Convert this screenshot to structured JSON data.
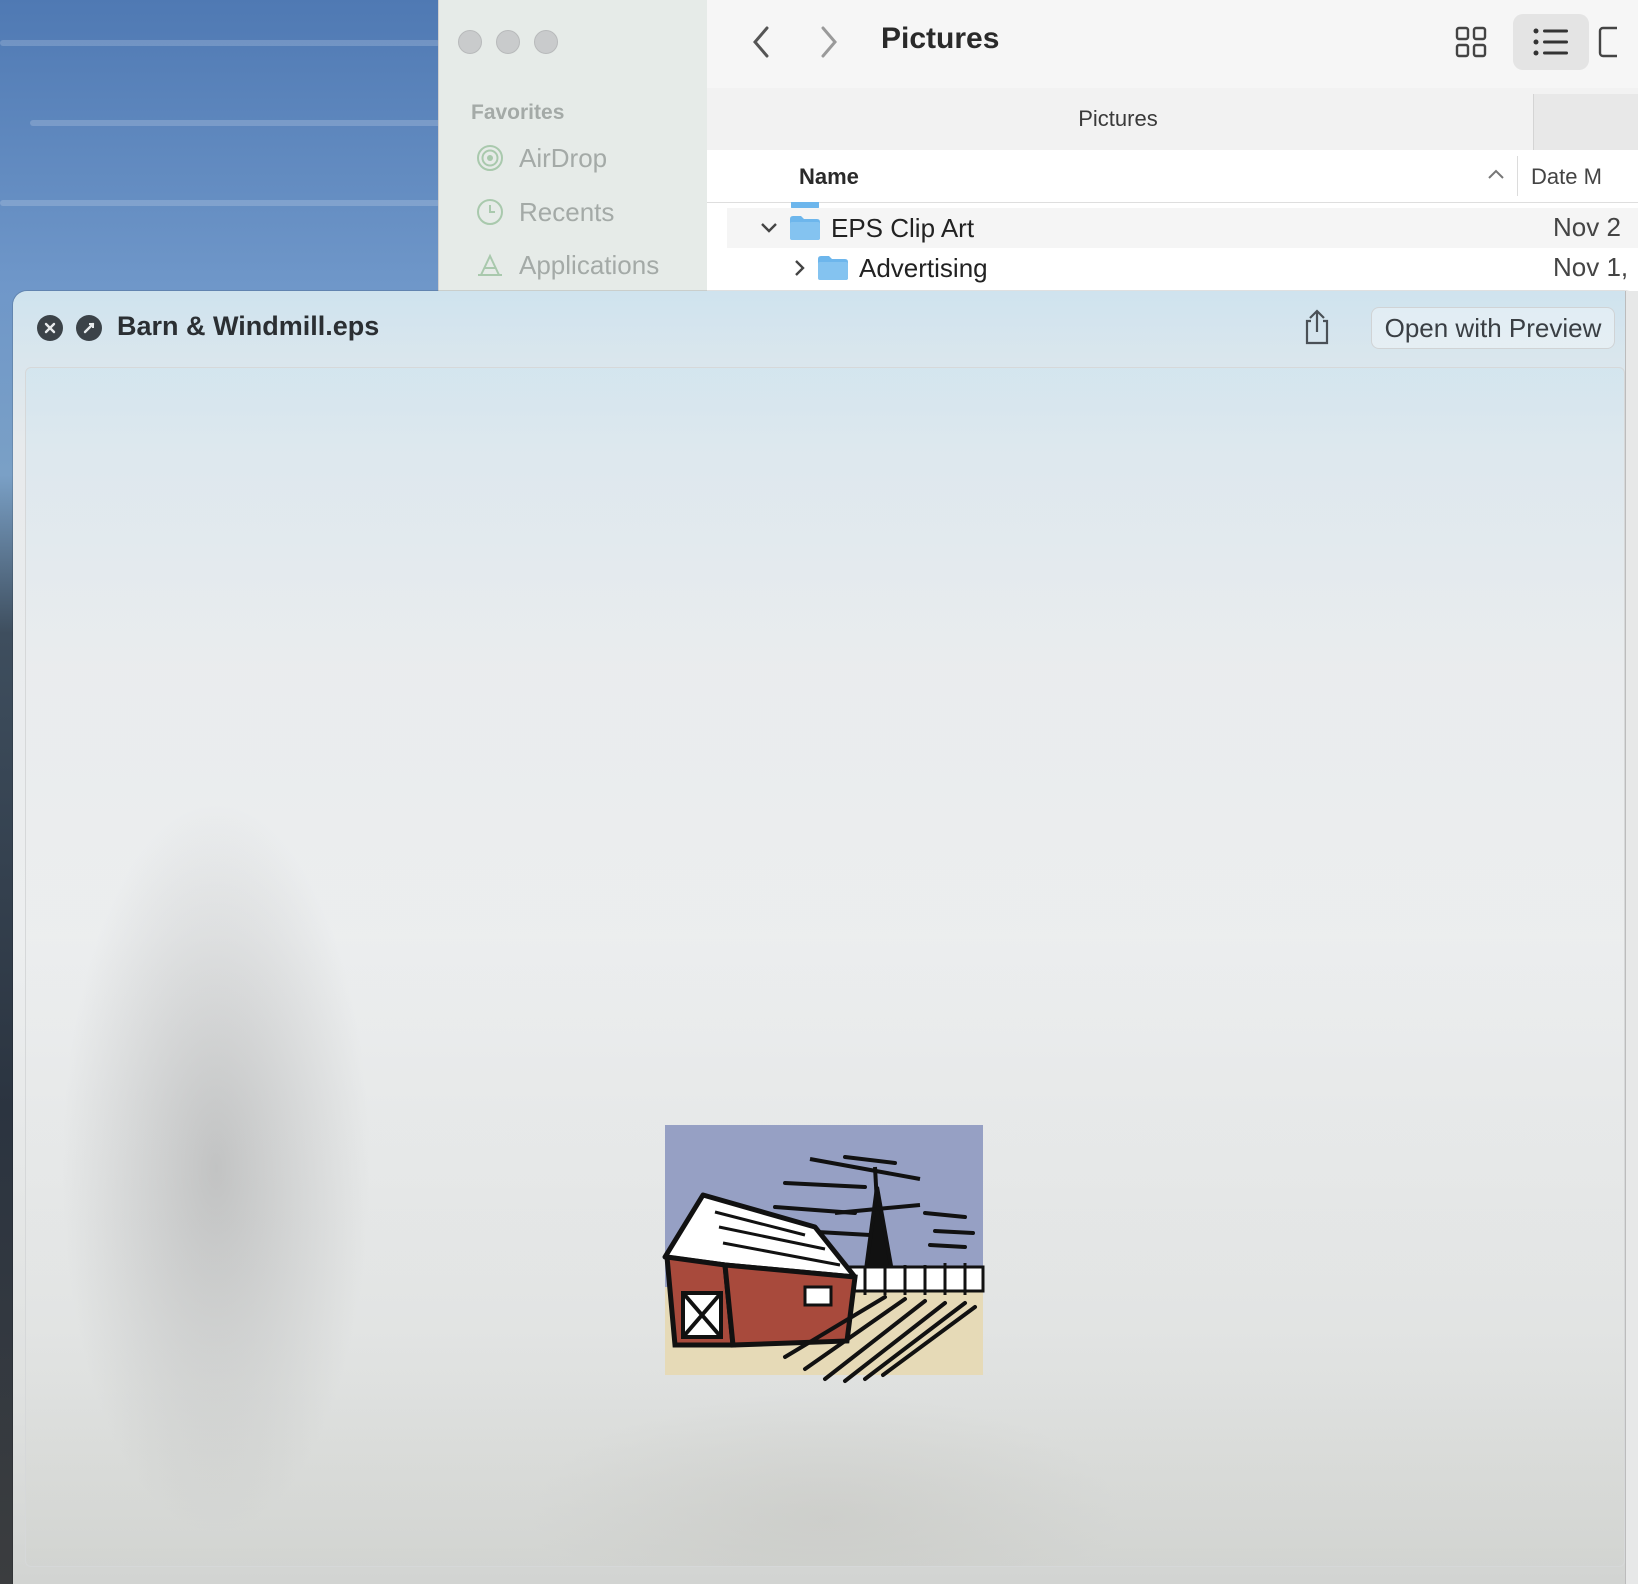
{
  "finder": {
    "title": "Pictures",
    "path_label": "Pictures",
    "sidebar": {
      "heading": "Favorites",
      "items": [
        {
          "label": "AirDrop",
          "icon": "airdrop-icon"
        },
        {
          "label": "Recents",
          "icon": "clock-icon"
        },
        {
          "label": "Applications",
          "icon": "applications-icon"
        }
      ]
    },
    "columns": {
      "name": "Name",
      "date": "Date M"
    },
    "rows": [
      {
        "name": "EPS Clip Art",
        "date": "Nov 2",
        "expanded": true
      },
      {
        "name": "Advertising",
        "date": "Nov 1,",
        "expanded": false
      }
    ]
  },
  "quicklook": {
    "title": "Barn & Windmill.eps",
    "open_label": "Open with Preview"
  },
  "colors": {
    "folder": "#6db6ec",
    "barn_red": "#a84a3c",
    "sky": "#96a0c4",
    "ground": "#e6dab7"
  }
}
